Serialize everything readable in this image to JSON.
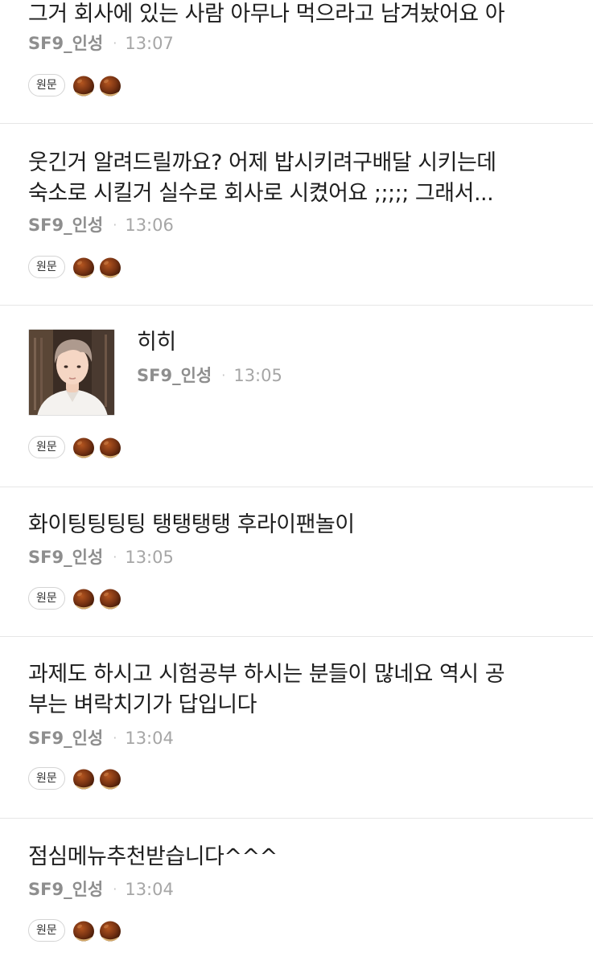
{
  "feed": {
    "posts": [
      {
        "text_lines": [
          "그거 회사에 있는 사람 아무나 먹으라고 남겨놨어요 아"
        ],
        "author": "SF9_인성",
        "time": "13:07",
        "original_label": "원문",
        "has_photo": false,
        "reaction_icon": "chestnut-icon"
      },
      {
        "text_lines": [
          "웃긴거 알려드릴까요? 어제 밥시키려구배달 시키는데",
          "숙소로 시킬거 실수로 회사로 시켰어요 ;;;;; 그래서..."
        ],
        "author": "SF9_인성",
        "time": "13:06",
        "original_label": "원문",
        "has_photo": false,
        "reaction_icon": "chestnut-icon"
      },
      {
        "text_lines": [
          "히히"
        ],
        "author": "SF9_인성",
        "time": "13:05",
        "original_label": "원문",
        "has_photo": true,
        "reaction_icon": "chestnut-icon"
      },
      {
        "text_lines": [
          "화이팅팅팅팅 탱탱탱탱 후라이팬놀이"
        ],
        "author": "SF9_인성",
        "time": "13:05",
        "original_label": "원문",
        "has_photo": false,
        "reaction_icon": "chestnut-icon"
      },
      {
        "text_lines": [
          "과제도 하시고 시험공부 하시는 분들이 많네요 역시 공",
          "부는 벼락치기가 답입니다"
        ],
        "author": "SF9_인성",
        "time": "13:04",
        "original_label": "원문",
        "has_photo": false,
        "reaction_icon": "chestnut-icon"
      },
      {
        "text_lines": [
          "점심메뉴추천받습니다^^^"
        ],
        "author": "SF9_인성",
        "time": "13:04",
        "original_label": "원문",
        "has_photo": false,
        "reaction_icon": "chestnut-icon"
      }
    ],
    "separator": "·",
    "colors": {
      "author": "#8e8e8e",
      "time": "#a6a6a6",
      "divider": "#e6e6e6",
      "chestnut": "#7a3413"
    }
  }
}
